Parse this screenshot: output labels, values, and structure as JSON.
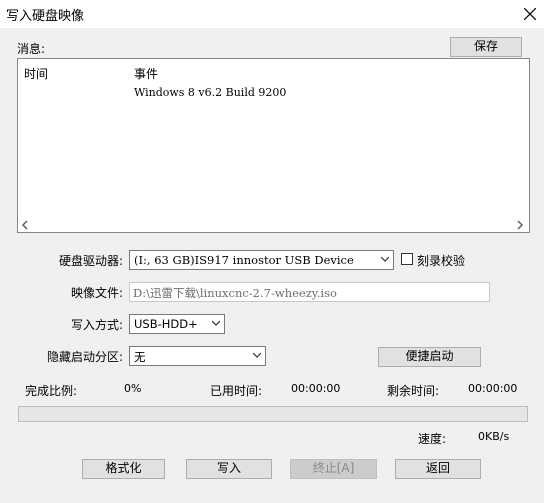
{
  "window": {
    "title": "写入硬盘映像"
  },
  "log": {
    "label": "消息:",
    "save_label": "保存",
    "columns": [
      "时间",
      "事件"
    ],
    "rows": [
      {
        "time": "",
        "event": "Windows 8 v6.2 Build 9200"
      }
    ]
  },
  "form": {
    "drive_label": "硬盘驱动器:",
    "drive_value": "(I:, 63 GB)IS917 innostor USB Device",
    "verify_label": "刻录校验",
    "verify_checked": false,
    "image_label": "映像文件:",
    "image_value": "D:\\迅雷下载\\linuxcnc-2.7-wheezy.iso",
    "method_label": "写入方式:",
    "method_value": "USB-HDD+",
    "hidden_label": "隐藏启动分区:",
    "hidden_value": "无",
    "quick_boot_label": "便捷启动"
  },
  "status": {
    "percent_label": "完成比例:",
    "percent_value": "0%",
    "elapsed_label": "已用时间:",
    "elapsed_value": "00:00:00",
    "remaining_label": "剩余时间:",
    "remaining_value": "00:00:00",
    "progress": 0,
    "speed_label": "速度:",
    "speed_value": "0KB/s"
  },
  "buttons": {
    "format": "格式化",
    "write": "写入",
    "abort": "终止[A]",
    "back": "返回"
  }
}
